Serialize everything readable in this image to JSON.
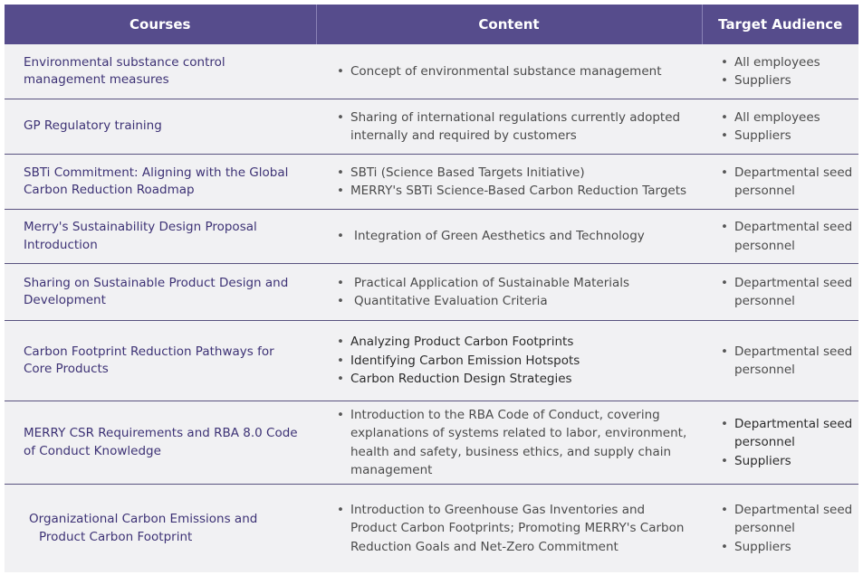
{
  "table": {
    "headers": {
      "courses": "Courses",
      "content": "Content",
      "audience": "Target Audience"
    },
    "rows": [
      {
        "course": [
          "Environmental substance control",
          "management measures"
        ],
        "content": [
          "Concept of environmental substance management"
        ],
        "audience": [
          "All employees",
          "Suppliers"
        ]
      },
      {
        "course": [
          "GP Regulatory training"
        ],
        "content": [
          "Sharing of international regulations currently adopted internally and required by customers"
        ],
        "audience": [
          "All employees",
          "Suppliers"
        ]
      },
      {
        "course": [
          "SBTi Commitment: Aligning with the Global",
          "Carbon Reduction Roadmap"
        ],
        "content": [
          "SBTi (Science Based Targets Initiative)",
          "MERRY's SBTi Science-Based Carbon Reduction Targets"
        ],
        "audience": [
          "Departmental seed personnel"
        ]
      },
      {
        "course": [
          "Merry's Sustainability Design Proposal",
          "Introduction"
        ],
        "content": [
          "Integration of Green Aesthetics and Technology"
        ],
        "audience": [
          "Departmental seed personnel"
        ]
      },
      {
        "course": [
          "Sharing on Sustainable Product Design and",
          "Development"
        ],
        "content": [
          "Practical Application of Sustainable Materials",
          "Quantitative Evaluation Criteria"
        ],
        "audience": [
          "Departmental seed personnel"
        ]
      },
      {
        "course": [
          "Carbon Footprint Reduction Pathways for",
          "Core Products"
        ],
        "content": [
          "Analyzing Product Carbon Footprints",
          "Identifying Carbon Emission Hotspots",
          "Carbon Reduction Design Strategies"
        ],
        "audience": [
          "Departmental seed personnel"
        ]
      },
      {
        "course": [
          "MERRY CSR Requirements and RBA 8.0 Code",
          "of Conduct Knowledge"
        ],
        "content": [
          "Introduction to the RBA Code of Conduct, covering explanations of systems related to labor, environment, health and safety, business ethics, and supply chain management"
        ],
        "audience": [
          "Departmental seed personnel",
          "Suppliers"
        ]
      },
      {
        "course": [
          "Organizational Carbon Emissions and",
          "Product Carbon Footprint"
        ],
        "content": [
          "Introduction to Greenhouse Gas Inventories and Product Carbon Footprints; Promoting MERRY's Carbon Reduction Goals and Net-Zero Commitment"
        ],
        "audience": [
          "Departmental seed personnel",
          "Suppliers"
        ]
      }
    ]
  }
}
